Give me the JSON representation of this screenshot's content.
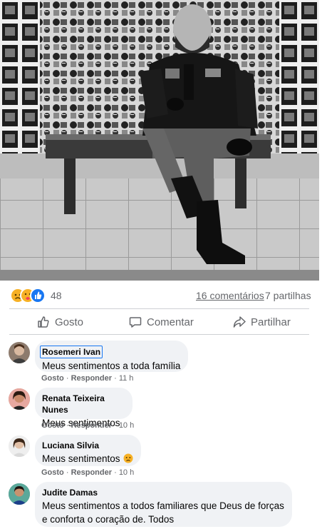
{
  "photo": {
    "alt_name": "post-photo"
  },
  "stats": {
    "reaction_count": "48",
    "comments_link": "16 comentários",
    "shares": "7 partilhas",
    "reaction_icons": [
      "sad-reaction-icon",
      "care-reaction-icon",
      "like-reaction-icon"
    ]
  },
  "actions": {
    "like_label": "Gosto",
    "comment_label": "Comentar",
    "share_label": "Partilhar"
  },
  "comments": [
    {
      "author": "Rosemeri Ivan",
      "text": "Meus sentimentos a toda família",
      "like": "Gosto",
      "reply": "Responder",
      "time": "11 h"
    },
    {
      "author": "Renata Teixeira Nunes",
      "text": "Meus sentimentos",
      "like": "Gosto",
      "reply": "Responder",
      "time": "10 h"
    },
    {
      "author": "Luciana Silvia",
      "text": "Meus sentimentos",
      "like": "Gosto",
      "reply": "Responder",
      "time": "10 h"
    },
    {
      "author": "Judite Damas",
      "text": "Meus sentimentos a todos familiares que Deus de forças e conforta o coração de. Todos"
    }
  ],
  "colors": {
    "meta_gray": "#65676b",
    "bubble_bg": "#f0f2f5",
    "focus_blue": "#1877f2",
    "like_blue": "#1877f2",
    "sad_yellow": "#f7b125"
  }
}
